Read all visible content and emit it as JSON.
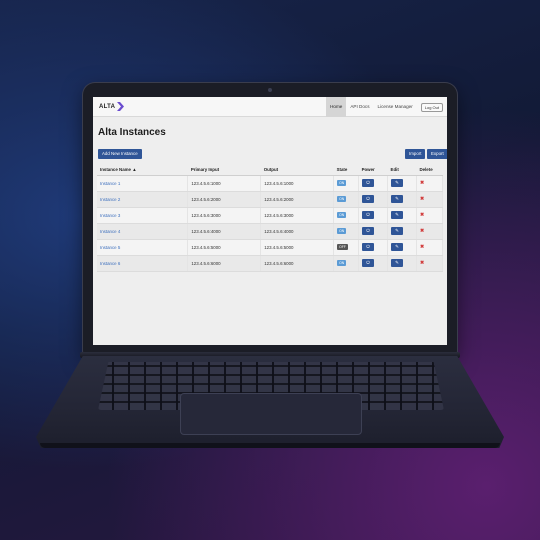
{
  "app": {
    "logo_text": "ALTA"
  },
  "nav": {
    "items": [
      "Home",
      "API Docs",
      "License Manager"
    ],
    "logout": "Log Out"
  },
  "page": {
    "title": "Alta Instances",
    "add_button": "Add New Instance",
    "import_button": "Import",
    "export_button": "Export"
  },
  "table": {
    "headers": [
      "Instance Name ▲",
      "Primary Input",
      "Output",
      "State",
      "Power",
      "Edit",
      "Delete"
    ],
    "rows": [
      {
        "name": "Instance 1",
        "input": "123.4.5.6:1000",
        "output": "123.4.5.6:1000",
        "state": "ON"
      },
      {
        "name": "Instance 2",
        "input": "123.4.5.6:2000",
        "output": "123.4.5.6:2000",
        "state": "ON"
      },
      {
        "name": "Instance 3",
        "input": "123.4.5.6:3000",
        "output": "123.4.5.6:3000",
        "state": "ON"
      },
      {
        "name": "Instance 4",
        "input": "123.4.5.6:4000",
        "output": "123.4.5.6:4000",
        "state": "ON"
      },
      {
        "name": "Instance 5",
        "input": "123.4.5.6:5000",
        "output": "123.4.5.6:5000",
        "state": "OFF"
      },
      {
        "name": "Instance 6",
        "input": "123.4.5.6:6000",
        "output": "123.4.5.6:6000",
        "state": "ON"
      }
    ]
  },
  "icons": {
    "power": "power-icon",
    "edit": "edit-icon",
    "delete": "delete-x-icon",
    "logo": "chevron-logo-icon"
  },
  "colors": {
    "primary_button": "#2f5597",
    "state_on": "#5b9bd5",
    "state_off": "#555555",
    "delete": "#d13b3b",
    "link": "#3b6ebd"
  }
}
